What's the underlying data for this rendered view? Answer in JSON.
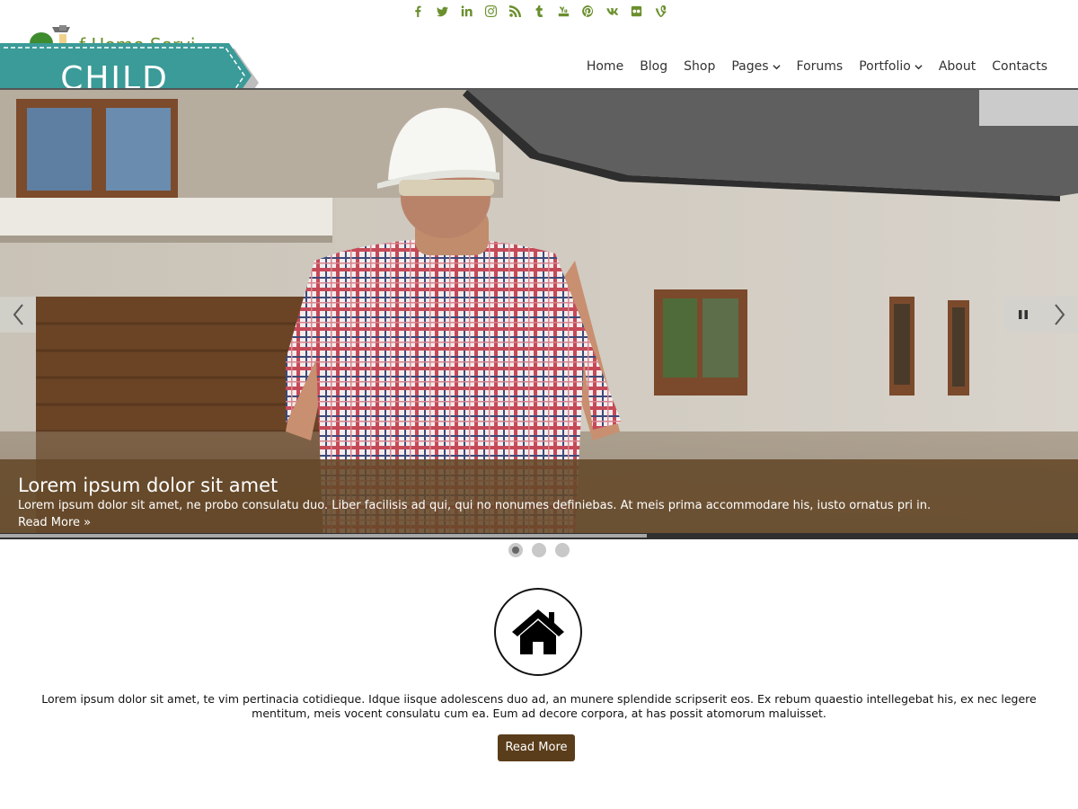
{
  "colors": {
    "social_icon": "#6a8f2c",
    "ribbon": "#3a9b98",
    "caption_bg": "#644828",
    "button_bg": "#5a3d1a",
    "nav_text": "#333333"
  },
  "social_icons": [
    "facebook-icon",
    "twitter-icon",
    "linkedin-icon",
    "instagram-icon",
    "rss-icon",
    "tumblr-icon",
    "youtube-icon",
    "pinterest-icon",
    "vk-icon",
    "flickr-icon",
    "vine-icon"
  ],
  "logo": {
    "site_name_partial": "f Home Servi",
    "ribbon_text": "CHILD"
  },
  "nav": {
    "items": [
      {
        "label": "Home"
      },
      {
        "label": "Blog"
      },
      {
        "label": "Shop"
      },
      {
        "label": "Pages"
      },
      {
        "label": "Forums"
      },
      {
        "label": "Portfolio"
      },
      {
        "label": "About"
      },
      {
        "label": "Contacts"
      }
    ]
  },
  "slider": {
    "caption_title": "Lorem ipsum dolor sit amet",
    "caption_text": "Lorem ipsum dolor sit amet, ne probo consulatu duo. Liber facilisis ad qui, qui no nonumes definiebas. At meis prima accommodare his, iusto ornatus pri in.",
    "read_more": "Read More »",
    "progress_fraction": 0.6,
    "slide_count": 3,
    "active_slide": 1
  },
  "feature": {
    "icon": "home-icon",
    "text": "Lorem ipsum dolor sit amet, te vim pertinacia cotidieque. Idque iisque adolescens duo ad, an munere splendide scripserit eos. Ex rebum quaestio intellegebat his, ex nec legere mentitum, meis vocent consulatu cum ea. Eum ad decore corpora, at has possit atomorum maluisset.",
    "button_label": "Read More"
  }
}
